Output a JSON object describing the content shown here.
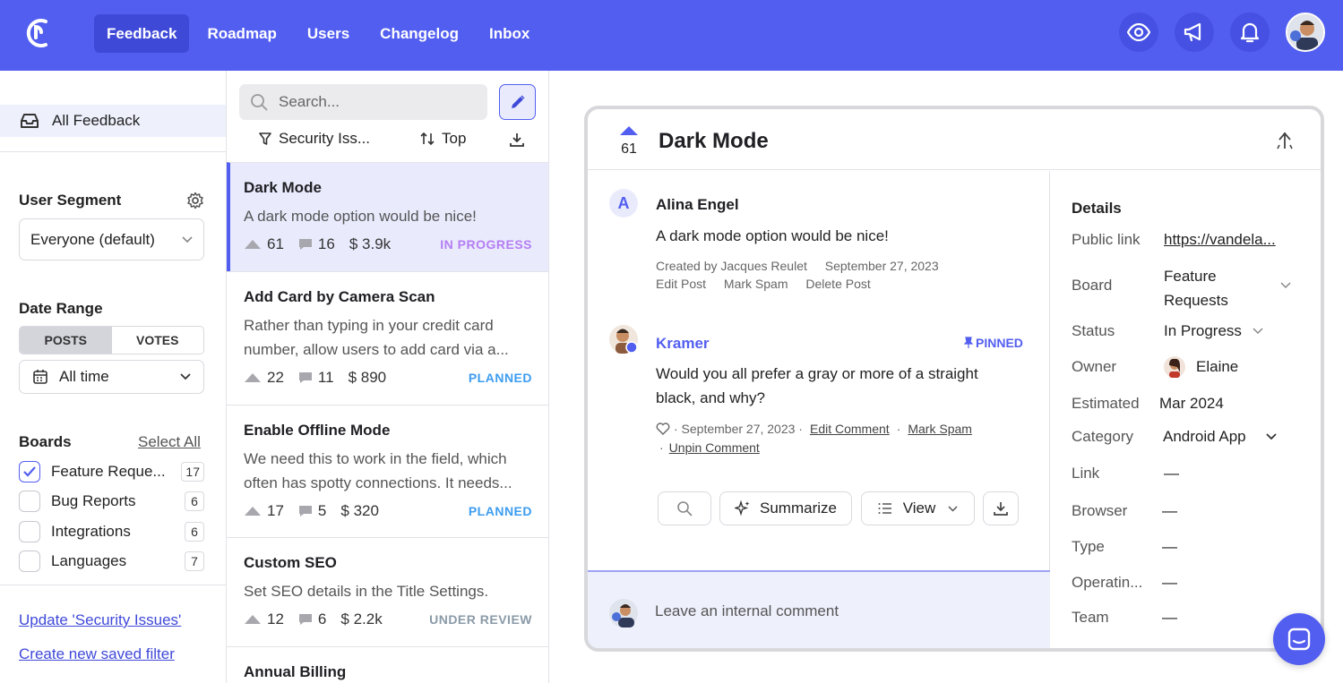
{
  "nav": {
    "tabs": [
      "Feedback",
      "Roadmap",
      "Users",
      "Changelog",
      "Inbox"
    ],
    "active_tab": "Feedback",
    "icons": [
      "eye-icon",
      "megaphone-icon",
      "bell-icon"
    ]
  },
  "sidebar": {
    "all_feedback": "All Feedback",
    "user_segment_label": "User Segment",
    "user_segment_value": "Everyone (default)",
    "date_range_label": "Date Range",
    "date_toggle": [
      "POSTS",
      "VOTES"
    ],
    "date_value": "All time",
    "boards_label": "Boards",
    "select_all": "Select All",
    "boards": [
      {
        "name": "Feature Reque...",
        "count": "17",
        "checked": true
      },
      {
        "name": "Bug Reports",
        "count": "6",
        "checked": false
      },
      {
        "name": "Integrations",
        "count": "6",
        "checked": false
      },
      {
        "name": "Languages",
        "count": "7",
        "checked": false
      }
    ],
    "update_filter": "Update 'Security Issues'",
    "new_filter": "Create new saved filter"
  },
  "list": {
    "search_placeholder": "Search...",
    "filter": "Security Iss...",
    "sort": "Top",
    "posts": [
      {
        "title": "Dark Mode",
        "desc": "A dark mode option would be nice!",
        "votes": "61",
        "comments": "16",
        "value": "$ 3.9k",
        "status": "IN PROGRESS",
        "status_color": "#b57df2"
      },
      {
        "title": "Add Card by Camera Scan",
        "desc": "Rather than typing in your credit card number, allow users to add card via a...",
        "votes": "22",
        "comments": "11",
        "value": "$ 890",
        "status": "PLANNED",
        "status_color": "#3d9df0"
      },
      {
        "title": "Enable Offline Mode",
        "desc": "We need this to work in the field, which often has spotty connections. It needs...",
        "votes": "17",
        "comments": "5",
        "value": "$ 320",
        "status": "PLANNED",
        "status_color": "#3d9df0"
      },
      {
        "title": "Custom SEO",
        "desc": "Set SEO details in the Title Settings.",
        "votes": "12",
        "comments": "6",
        "value": "$ 2.2k",
        "status": "UNDER REVIEW",
        "status_color": "#8a9aa8"
      },
      {
        "title": "Annual Billing",
        "desc": "",
        "votes": "",
        "comments": "",
        "value": "",
        "status": "",
        "status_color": "#8a9aa8"
      }
    ]
  },
  "detail": {
    "votes": "61",
    "title": "Dark Mode",
    "post": {
      "avatar_letter": "A",
      "author": "Alina Engel",
      "text": "A dark mode option would be nice!",
      "created_by": "Created by Jacques Reulet",
      "date": "September 27, 2023",
      "actions": [
        "Edit Post",
        "Mark Spam",
        "Delete Post"
      ]
    },
    "comment": {
      "author": "Kramer",
      "pinned": "PINNED",
      "text": "Would you all prefer a gray or more of a straight black, and why?",
      "date": "· September 27, 2023 ·",
      "actions": [
        "Edit Comment",
        "Mark Spam",
        "Unpin Comment"
      ]
    },
    "toolbar": {
      "summarize": "Summarize",
      "view": "View"
    },
    "internal_placeholder": "Leave an internal comment",
    "details": {
      "heading": "Details",
      "rows": [
        {
          "label": "Public link",
          "value": "https://vandela..."
        },
        {
          "label": "Board",
          "value": "Feature Requests"
        },
        {
          "label": "Status",
          "value": "In Progress"
        },
        {
          "label": "Owner",
          "value": "Elaine"
        },
        {
          "label": "Estimated",
          "value": "Mar 2024"
        },
        {
          "label": "Category",
          "value": "Android App"
        },
        {
          "label": "Link",
          "value": "—"
        },
        {
          "label": "Browser",
          "value": "—"
        },
        {
          "label": "Type",
          "value": "—"
        },
        {
          "label": "Operatin...",
          "value": "—"
        },
        {
          "label": "Team",
          "value": "—"
        }
      ]
    }
  },
  "colors": {
    "brand": "#525ef0",
    "brand_dark": "#3f49d8",
    "selected_bg": "#e9ebfd"
  }
}
